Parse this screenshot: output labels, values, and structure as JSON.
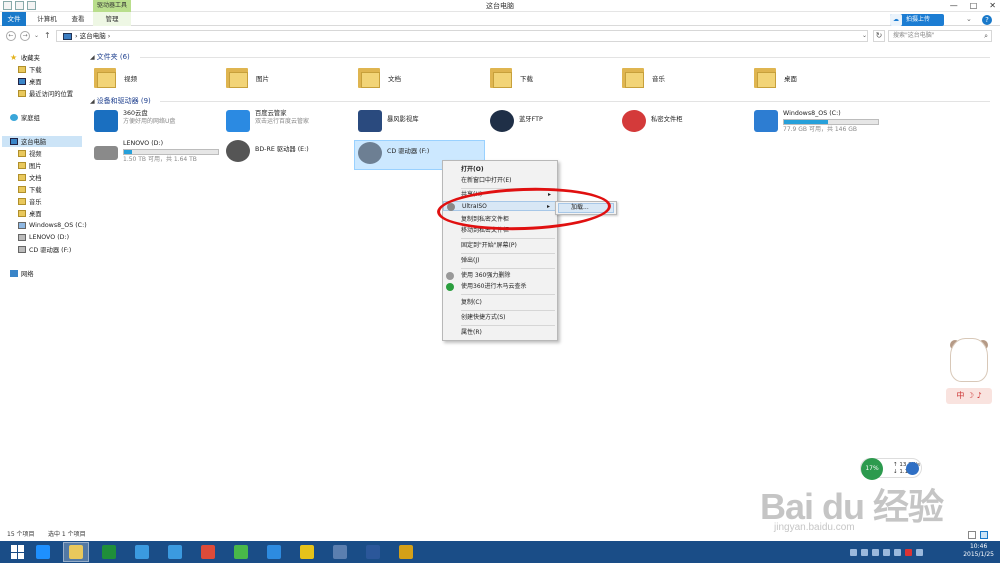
{
  "window": {
    "title": "这台电脑",
    "contextual_tab_group": "驱动器工具",
    "controls": {
      "minimize": "—",
      "maximize": "□",
      "close": "✕"
    }
  },
  "ribbon": {
    "tabs": [
      {
        "label": "文件",
        "active": true
      },
      {
        "label": "计算机"
      },
      {
        "label": "查看"
      },
      {
        "label": "管理"
      }
    ],
    "cloud_upload": "拍摄上传",
    "expand": "⌄",
    "help": "?"
  },
  "address": {
    "back": "←",
    "forward": "→",
    "dropdown": "⌄",
    "up": "↑",
    "path": "这台电脑",
    "path_chevron": "›",
    "refresh": "↻",
    "search_placeholder": "搜索\"这台电脑\"",
    "search_icon": "search-icon"
  },
  "nav": {
    "favorites": {
      "label": "收藏夹",
      "items": [
        "下载",
        "桌面",
        "最近访问的位置"
      ]
    },
    "homegroup": "家庭组",
    "this_pc": {
      "label": "这台电脑",
      "items": [
        "视频",
        "图片",
        "文档",
        "下载",
        "音乐",
        "桌面",
        "Windows8_OS (C:)",
        "LENOVO (D:)",
        "CD 驱动器 (F:)"
      ]
    },
    "network": "网络"
  },
  "content": {
    "folders_header": "文件夹 (6)",
    "folders": [
      "视频",
      "图片",
      "文档",
      "下载",
      "音乐",
      "桌面"
    ],
    "devices_header": "设备和驱动器 (9)",
    "devices": {
      "d360": {
        "name": "360云盘",
        "sub": "方便好用的网络U盘",
        "color": "#1a6fc0"
      },
      "baidu": {
        "name": "百度云管家",
        "sub": "双击运行百度云管家",
        "color": "#2b8ae2"
      },
      "baofeng": {
        "name": "暴风影视库",
        "color": "#2a4a7e"
      },
      "bluetooth": {
        "name": "蓝牙FTP",
        "color": "#1f2f47"
      },
      "private": {
        "name": "私密文件柜",
        "color": "#d43a3a"
      },
      "cdrive": {
        "name": "Windows8_OS (C:)",
        "sub": "77.9 GB 可用，共 146 GB",
        "used": 0.47,
        "color": "#2d7dd2"
      },
      "lenovo": {
        "name": "LENOVO (D:)",
        "sub": "1.50 TB 可用，共 1.64 TB",
        "used": 0.09,
        "color": "#8a8a8a"
      },
      "bdre": {
        "name": "BD-RE 驱动器 (E:)",
        "color": "#555555"
      },
      "cdf": {
        "name": "CD 驱动器 (F:)",
        "color": "#6d7f93"
      }
    }
  },
  "context_menu": {
    "open": "打开(O)",
    "open_new": "在新窗口中打开(E)",
    "share": "共享(H)",
    "ultraiso": "UltraISO",
    "copy_private": "复制到私密文件柜",
    "move_private": "移动到私密文件柜",
    "pin_start": "固定到\"开始\"屏幕(P)",
    "eject": "弹出(J)",
    "shred": "使用 360强力删除",
    "scan": "使用360进行木马云查杀",
    "copy": "复制(C)",
    "shortcut": "创建快捷方式(S)",
    "properties": "属性(R)",
    "submenu_arrow": "▸",
    "submenu": {
      "load": "加载..."
    }
  },
  "status": {
    "count": "15 个项目",
    "selected": "选中 1 个项目"
  },
  "widgets": {
    "speed_percent": "17%",
    "up_speed": "↑ 13.2K/s",
    "down_speed": "↓ 1.1K/s",
    "pet_bar": "中 ☽ ♪"
  },
  "watermark": {
    "logo": "Bai du 经验",
    "url": "jingyan.baidu.com"
  },
  "taskbar": {
    "apps": [
      {
        "name": "ie",
        "color": "#1e90ff"
      },
      {
        "name": "explorer",
        "color": "#e9c85c"
      },
      {
        "name": "excel-store",
        "color": "#1f8f3a"
      },
      {
        "name": "cloud360",
        "color": "#3b9ae0"
      },
      {
        "name": "baidu-cloud",
        "color": "#3b9ae0"
      },
      {
        "name": "chrome",
        "color": "#dd4b39"
      },
      {
        "name": "360-guard",
        "color": "#49b849"
      },
      {
        "name": "360-browser",
        "color": "#2d8be0"
      },
      {
        "name": "games",
        "color": "#e6c31a"
      },
      {
        "name": "remote",
        "color": "#5b7fb0"
      },
      {
        "name": "word",
        "color": "#2b579a"
      },
      {
        "name": "gallery",
        "color": "#d4a018"
      }
    ],
    "time": "10:46",
    "date": "2015/1/25"
  }
}
